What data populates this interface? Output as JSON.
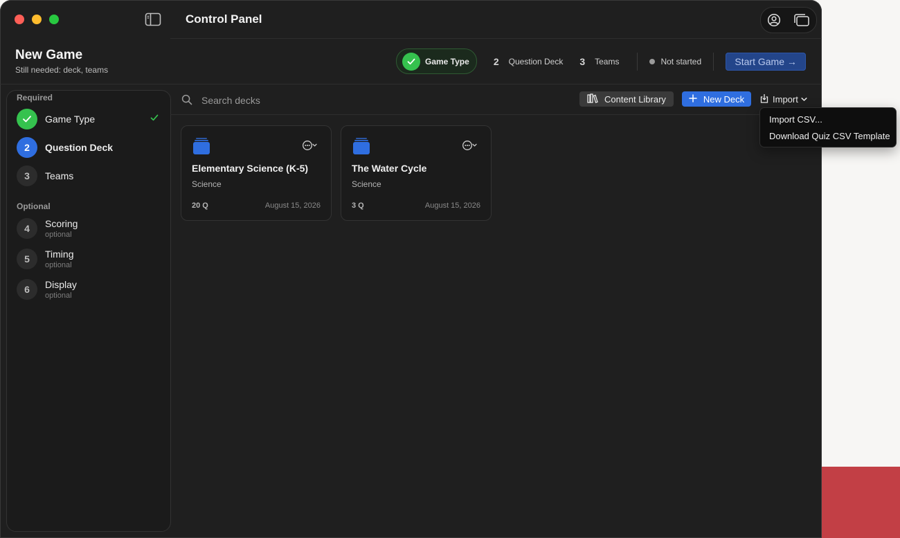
{
  "window": {
    "title": "Control Panel"
  },
  "header": {
    "title": "New Game",
    "subtitle": "Still needed: deck, teams"
  },
  "stepper": {
    "steps": [
      {
        "number": "",
        "label": "Game Type",
        "state": "done"
      },
      {
        "number": "2",
        "label": "Question Deck",
        "state": "pending"
      },
      {
        "number": "3",
        "label": "Teams",
        "state": "pending"
      }
    ],
    "status": "Not started",
    "start_label": "Start Game →"
  },
  "sidebar": {
    "required_label": "Required",
    "optional_label": "Optional",
    "required_items": [
      {
        "number": "",
        "label": "Game Type",
        "state": "done"
      },
      {
        "number": "2",
        "label": "Question Deck",
        "state": "active"
      },
      {
        "number": "3",
        "label": "Teams",
        "state": "pending"
      }
    ],
    "optional_items": [
      {
        "number": "4",
        "label": "Scoring",
        "hint": "optional"
      },
      {
        "number": "5",
        "label": "Timing",
        "hint": "optional"
      },
      {
        "number": "6",
        "label": "Display",
        "hint": "optional"
      }
    ]
  },
  "toolbar": {
    "search_placeholder": "Search decks",
    "content_library_label": "Content Library",
    "new_deck_label": "New Deck",
    "import_label": "Import"
  },
  "decks": [
    {
      "title": "Elementary Science (K-5)",
      "subject": "Science",
      "count": "20 Q",
      "date": "August 15, 2026"
    },
    {
      "title": "The Water Cycle",
      "subject": "Science",
      "count": "3 Q",
      "date": "August 15, 2026"
    }
  ],
  "import_menu": {
    "items": [
      "Import CSV...",
      "Download Quiz CSV Template"
    ]
  },
  "colors": {
    "accent_blue": "#2f6ee0",
    "success_green": "#35c24e",
    "window_bg": "#1f1f1f"
  }
}
